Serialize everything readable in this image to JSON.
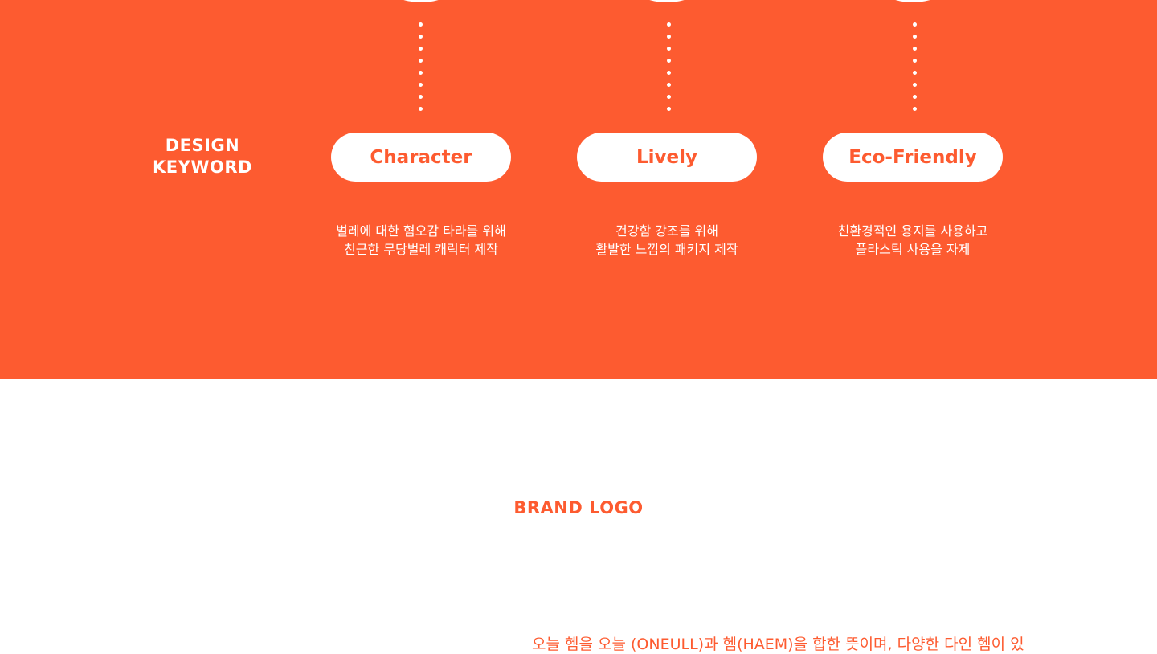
{
  "colors": {
    "accent": "#fd5b30",
    "background": "#ffffff",
    "on_accent": "#ffffff"
  },
  "design_keyword": {
    "label_line1": "DESIGN",
    "label_line2": "KEYWORD",
    "keywords": [
      {
        "title": "Character",
        "desc_line1": "벌레에 대한 혐오감 타라를 위해",
        "desc_line2": "친근한 무당벌레 캐릭터 제작"
      },
      {
        "title": "Lively",
        "desc_line1": "건강함 강조를 위해",
        "desc_line2": "활발한 느낌의 패키지 제작"
      },
      {
        "title": "Eco-Friendly",
        "desc_line1": "친환경적인 용지를 사용하고",
        "desc_line2": "플라스틱 사용을 자제"
      }
    ]
  },
  "brand_logo": {
    "title": "BRAND LOGO",
    "description_partial": "오늘 헴을 오늘 (ONEULL)과 헴(HAEM)을 합한 뜻이며, 다양한 다인 헴이 있"
  }
}
